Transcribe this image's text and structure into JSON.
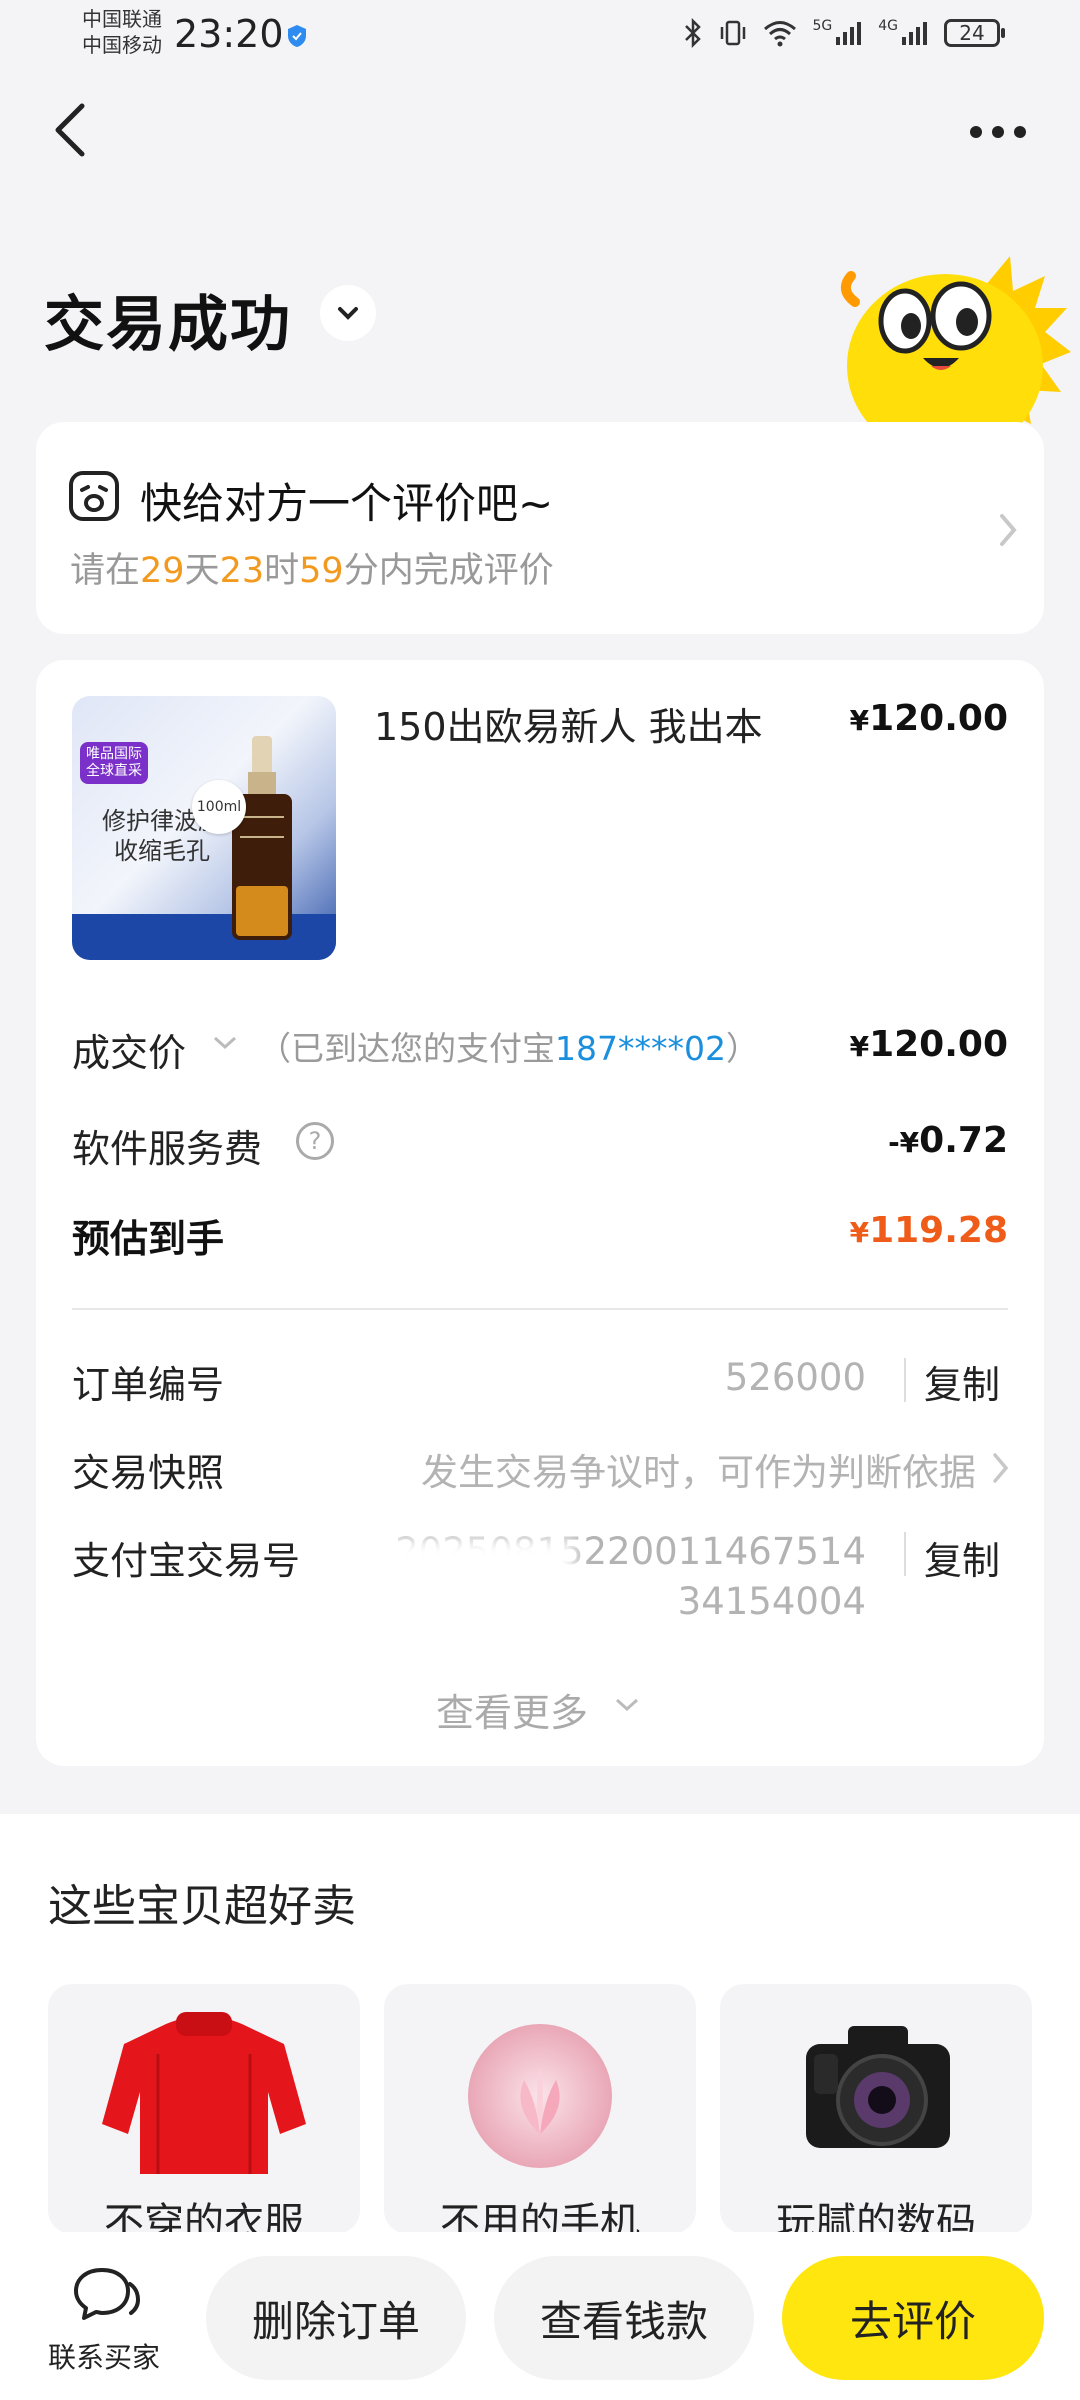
{
  "status_bar": {
    "carrier1": "中国联通",
    "carrier2": "中国移动",
    "time": "23:20",
    "battery": "24",
    "signal_labels": [
      "5G",
      "4G"
    ]
  },
  "header": {
    "title": "交易成功"
  },
  "rating": {
    "title": "快给对方一个评价吧~",
    "prefix": "请在",
    "days": "29",
    "days_unit": "天",
    "hours": "23",
    "hours_unit": "时",
    "minutes": "59",
    "suffix": "分内完成评价"
  },
  "product": {
    "title": "150出欧易新人 我出本",
    "price_symbol": "¥",
    "price": "120.00",
    "image": {
      "tag_line1": "唯品国际",
      "tag_line2": "全球直采",
      "text_line1": "修护律波肽",
      "text_line2": "收缩毛孔",
      "volume": "100ml"
    }
  },
  "summary": {
    "deal_label": "成交价",
    "deal_note_prefix": "（已到达您的支付宝",
    "deal_account": "187****02",
    "deal_note_suffix": "）",
    "deal_symbol": "¥",
    "deal_price": "120.00",
    "fee_label": "软件服务费",
    "fee_help": "?",
    "fee_symbol": "-¥",
    "fee_price": "0.72",
    "total_label": "预估到手",
    "total_symbol": "¥",
    "total_price": "119.28"
  },
  "order_info": {
    "order_no_label": "订单编号",
    "order_no_visible": "526000",
    "copy_label": "复制",
    "snapshot_label": "交易快照",
    "snapshot_value": "发生交易争议时，可作为判断依据",
    "alipay_label": "支付宝交易号",
    "alipay_line1": "20250815220011467514",
    "alipay_line2": "34154004",
    "see_more": "查看更多"
  },
  "recommend": {
    "title": "这些宝贝超好卖",
    "items": [
      {
        "label": "不穿的衣服"
      },
      {
        "label": "不用的手机"
      },
      {
        "label": "玩腻的数码"
      }
    ]
  },
  "bottom_bar": {
    "contact_label": "联系买家",
    "delete_label": "删除订单",
    "view_money_label": "查看钱款",
    "review_label": "去评价"
  },
  "colors": {
    "accent_yellow": "#ffe60f",
    "price_orange": "#ef5b19",
    "countdown_orange": "#f29a1f",
    "link_blue": "#1a8fde"
  }
}
